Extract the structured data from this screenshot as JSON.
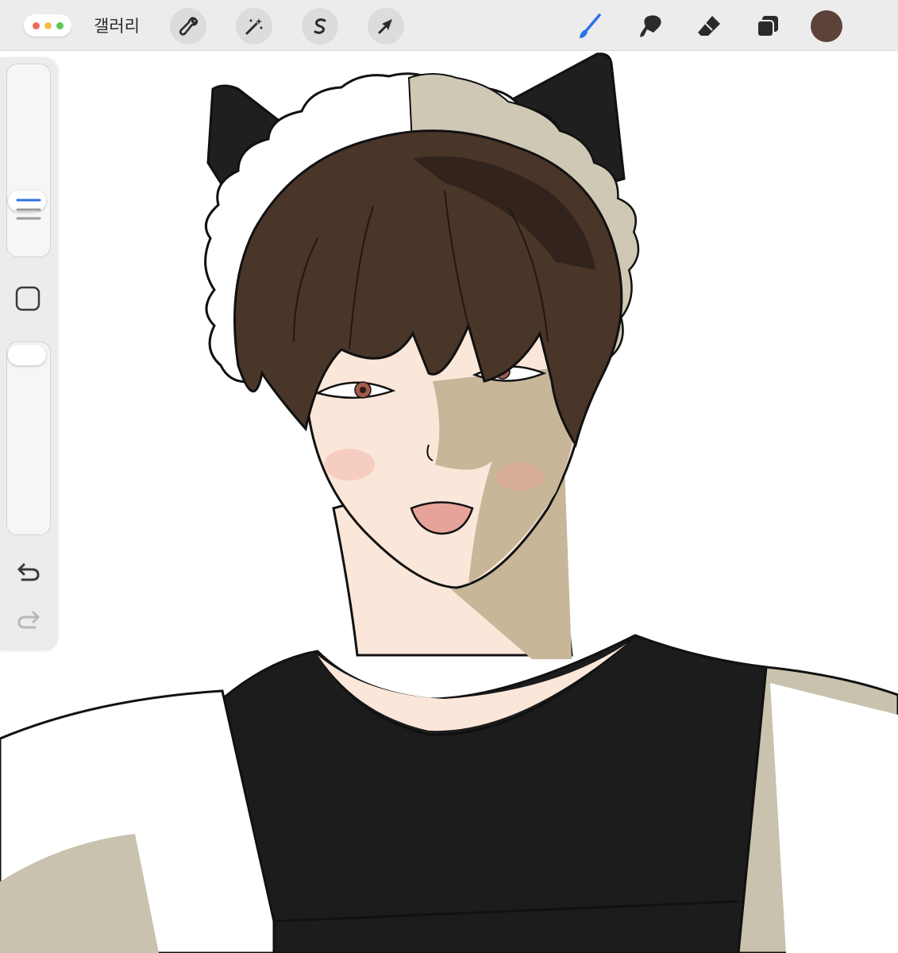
{
  "app": {
    "gallery_label": "갤러리",
    "accent_color": "#2c72e8",
    "current_color": "#5c4238",
    "window_controls": [
      "close-dot",
      "minimize-dot",
      "zoom-dot"
    ]
  },
  "toolbar_left": [
    {
      "name": "actions-button",
      "icon": "wrench-icon"
    },
    {
      "name": "adjustments-button",
      "icon": "magic-wand-icon"
    },
    {
      "name": "selection-button",
      "icon": "s-selection-icon"
    },
    {
      "name": "transform-button",
      "icon": "arrow-cursor-icon"
    }
  ],
  "toolbar_right": [
    {
      "name": "brush-tool",
      "icon": "brush-icon",
      "active": true
    },
    {
      "name": "smudge-tool",
      "icon": "smudge-icon",
      "active": false
    },
    {
      "name": "eraser-tool",
      "icon": "eraser-icon",
      "active": false
    },
    {
      "name": "layers-button",
      "icon": "layers-icon",
      "active": false
    },
    {
      "name": "color-swatch",
      "icon": "color-circle",
      "active": false
    }
  ],
  "sidebar": {
    "brush_size_slider": {
      "icon": "size-lines-icon"
    },
    "modifier_button": {
      "icon": "square-icon"
    },
    "opacity_slider": {
      "icon": "knob"
    },
    "undo": {
      "icon": "undo-icon"
    },
    "redo": {
      "icon": "redo-icon",
      "enabled": false
    }
  },
  "artwork": {
    "palette": {
      "hair": "#4a3529",
      "hair_shadow": "#2e201a",
      "skin": "#fbe7da",
      "skin_shadow": "#c8b698",
      "headband": "#ffffff",
      "headband_shadow": "#cfc8b5",
      "ears": "#1f1f1f",
      "shirt": "#1c1c1c",
      "apron": "#ffffff",
      "apron_shadow": "#c9c2ae",
      "eyes": "#a35a4f",
      "mouth": "#e6a39a",
      "line": "#111111"
    }
  }
}
